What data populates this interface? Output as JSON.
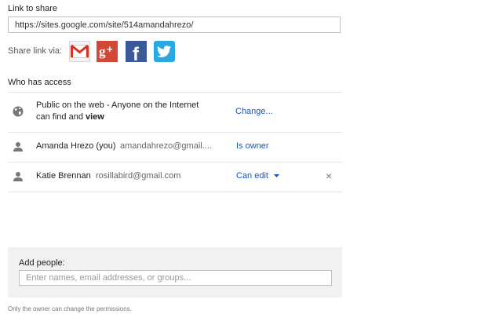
{
  "link_section": {
    "title": "Link to share",
    "url": "https://sites.google.com/site/514amandahrezo/",
    "share_via_label": "Share link via:",
    "share_services": [
      {
        "name": "Gmail",
        "icon": "gmail-icon",
        "color": "#d93025"
      },
      {
        "name": "Google+",
        "icon": "google-plus-icon",
        "color": "#d14836"
      },
      {
        "name": "Facebook",
        "icon": "facebook-icon",
        "color": "#3b5998"
      },
      {
        "name": "Twitter",
        "icon": "twitter-icon",
        "color": "#2aa9e0"
      }
    ]
  },
  "access_section": {
    "title": "Who has access",
    "rows": [
      {
        "icon": "globe-icon",
        "line1": "Public on the web - Anyone on the Internet",
        "line2_prefix": "can find and ",
        "line2_bold": "view",
        "action": "Change..."
      },
      {
        "icon": "person-icon",
        "name": "Amanda Hrezo (you)",
        "email": "amandahrezo@gmail....",
        "role": "Is owner"
      },
      {
        "icon": "person-icon",
        "name": "Katie Brennan",
        "email": "rosillabird@gmail.com",
        "role": "Can edit",
        "remove_symbol": "×"
      }
    ]
  },
  "add_people": {
    "label": "Add people:",
    "placeholder": "Enter names, email addresses, or groups..."
  },
  "footnote": "Only the owner can change the permissions.",
  "colors": {
    "link_blue": "#1155cc",
    "divider": "#e5e5e5",
    "panel_bg": "#f1f1f1"
  }
}
